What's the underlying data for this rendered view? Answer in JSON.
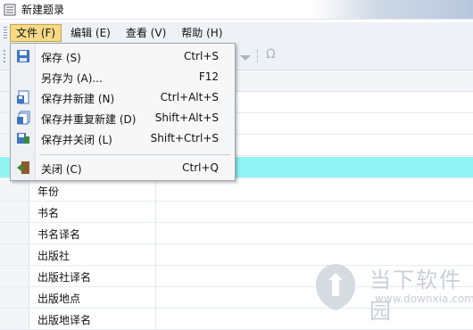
{
  "window": {
    "title": "新建题录"
  },
  "menubar": {
    "items": [
      {
        "label": "文件 (F)",
        "active": true
      },
      {
        "label": "编辑 (E)"
      },
      {
        "label": "查看 (V)"
      },
      {
        "label": "帮助 (H)"
      }
    ]
  },
  "file_menu": {
    "items": [
      {
        "label": "保存 (S)",
        "shortcut": "Ctrl+S",
        "icon": "save-icon"
      },
      {
        "label": "另存为 (A)...",
        "shortcut": "F12",
        "icon": ""
      },
      {
        "label": "保存并新建 (N)",
        "shortcut": "Ctrl+Alt+S",
        "icon": "save-new-icon"
      },
      {
        "label": "保存并重复新建 (D)",
        "shortcut": "Shift+Alt+S",
        "icon": "save-repeat-new-icon"
      },
      {
        "label": "保存并关闭 (L)",
        "shortcut": "Shift+Ctrl+S",
        "icon": "save-close-icon"
      },
      {
        "label": "关闭 (C)",
        "shortcut": "Ctrl+Q",
        "icon": "close-door-icon"
      }
    ]
  },
  "toolbar": {
    "omega_symbol": "Ω"
  },
  "fields": {
    "rows": [
      {
        "label": ""
      },
      {
        "label": ""
      },
      {
        "label": ""
      },
      {
        "label": "",
        "selected": true
      },
      {
        "label": "年份"
      },
      {
        "label": "书名"
      },
      {
        "label": "书名译名"
      },
      {
        "label": "出版社"
      },
      {
        "label": "出版社译名"
      },
      {
        "label": "出版地点"
      },
      {
        "label": "出版地译名"
      }
    ]
  },
  "watermark": {
    "title": "当下软件园",
    "url": "www.downxia.com"
  },
  "colors": {
    "selected_row": "#90f4f4",
    "menu_active": "#f6d985"
  }
}
